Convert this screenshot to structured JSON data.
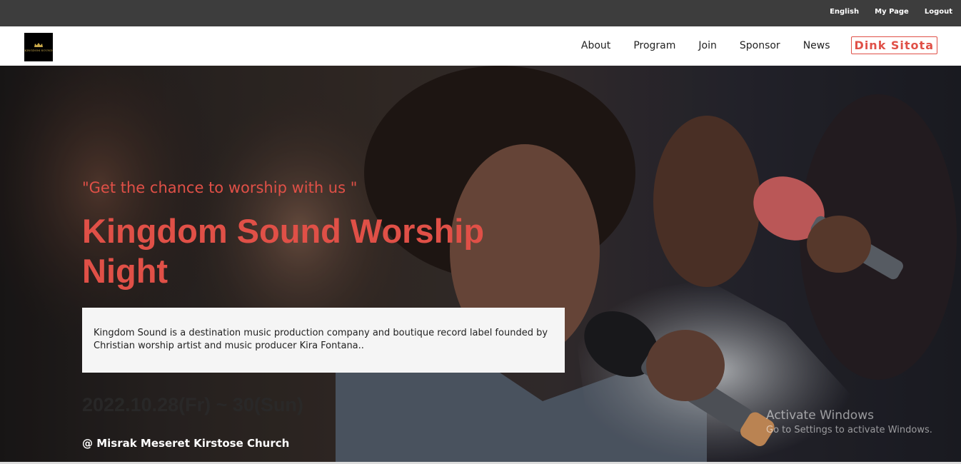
{
  "topbar": {
    "links": [
      "English",
      "My Page",
      "Logout"
    ]
  },
  "logo": {
    "text": "KINGDOM SOUND"
  },
  "nav": {
    "items": [
      "About",
      "Program",
      "Join",
      "Sponsor",
      "News"
    ],
    "cta": "Dink Sitota"
  },
  "hero": {
    "tagline": "\"Get the chance to worship with us \"",
    "title": "Kingdom Sound Worship Night",
    "description": "Kingdom Sound is a destination music production company and boutique record label founded by Christian worship artist and music producer Kira Fontana..",
    "dates": "2022.10.28(Fr) ~ 30(Sun)",
    "venue": "@ Misrak Meseret Kirstose Church"
  },
  "watermark": {
    "title": "Activate Windows",
    "subtitle": "Go to Settings to activate Windows."
  },
  "colors": {
    "accent": "#e05047",
    "topbar": "#3d3d3d"
  }
}
